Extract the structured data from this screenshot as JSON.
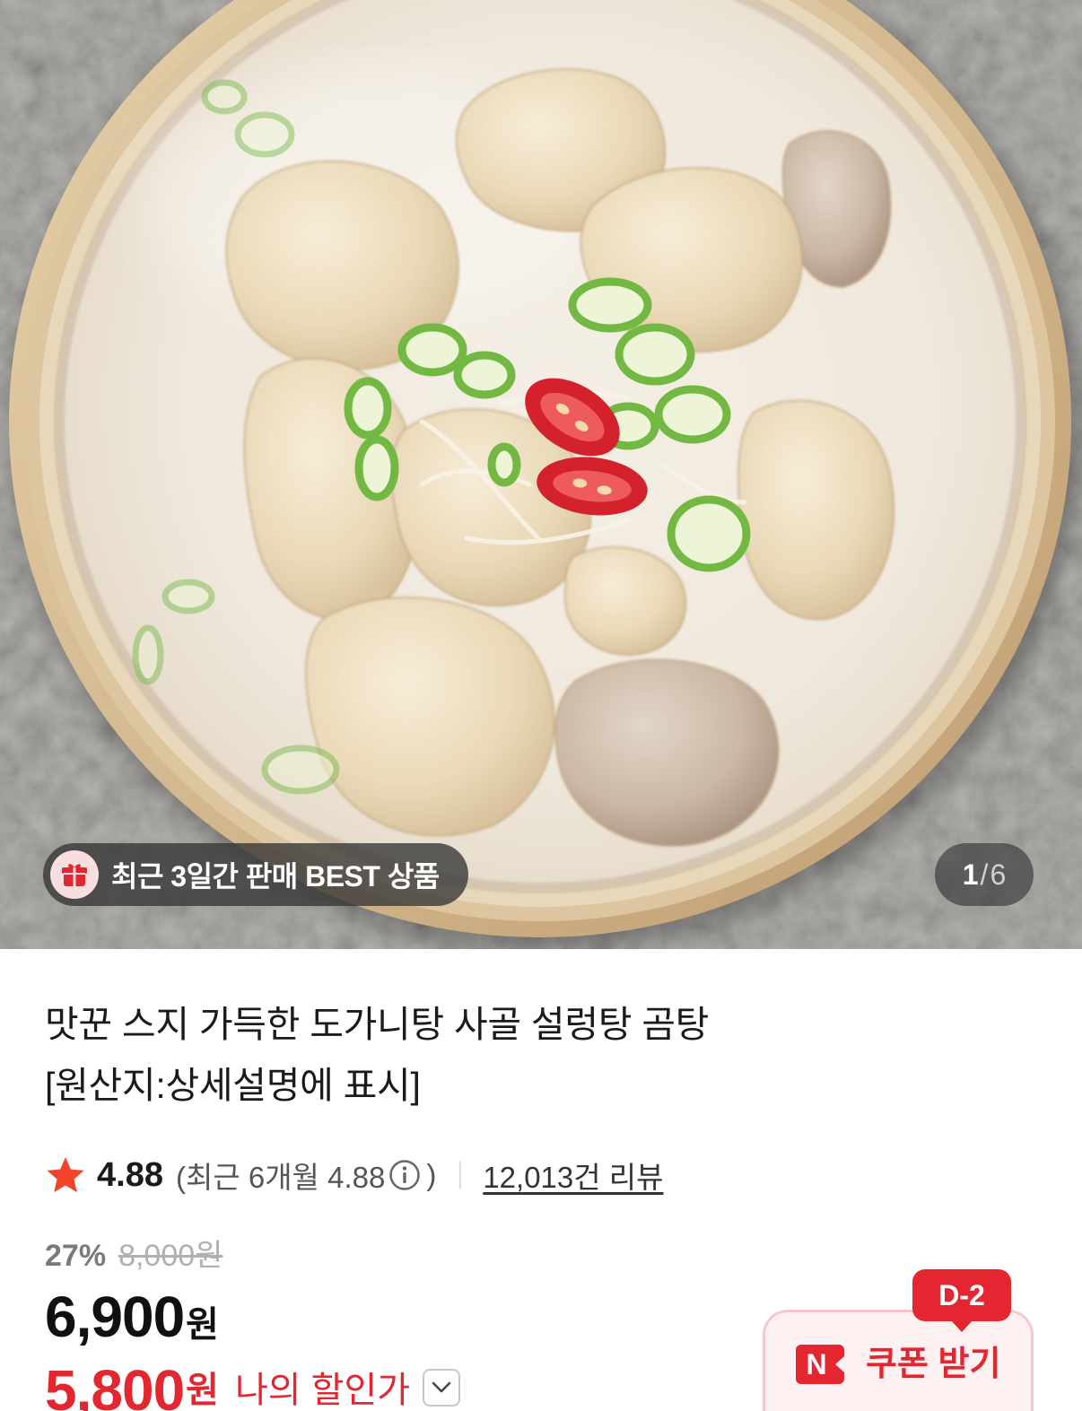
{
  "gallery": {
    "badge_text": "최근 3일간 판매 BEST 상품",
    "counter_current": "1",
    "counter_separator": "/",
    "counter_total": "6"
  },
  "product": {
    "title_lines": [
      "맛꾼 스지 가득한 도가니탕 사골 설렁탕 곰탕",
      "[원산지:상세설명에 표시]"
    ]
  },
  "rating": {
    "score": "4.88",
    "recent_text": "(최근 6개월 4.88",
    "recent_close": ")",
    "review_count": "12,013건 리뷰"
  },
  "price": {
    "discount_rate": "27%",
    "original_price": "8,000원",
    "sale_amount": "6,900",
    "sale_currency": "원",
    "my_amount": "5,800",
    "my_currency": "원",
    "my_label": "나의 할인가"
  },
  "coupon": {
    "deadline_badge": "D-2",
    "logo_text": "N",
    "label": "쿠폰 받기"
  },
  "icons": {
    "badge": "gift-icon",
    "rating": "star-icon",
    "rating_info": "info-icon",
    "price_toggle": "chevron-down-icon",
    "coupon_logo": "n-logo-icon"
  },
  "colors": {
    "accent_red": "#e3262f",
    "star": "#f2442b",
    "text_primary": "#1a1a1a"
  }
}
